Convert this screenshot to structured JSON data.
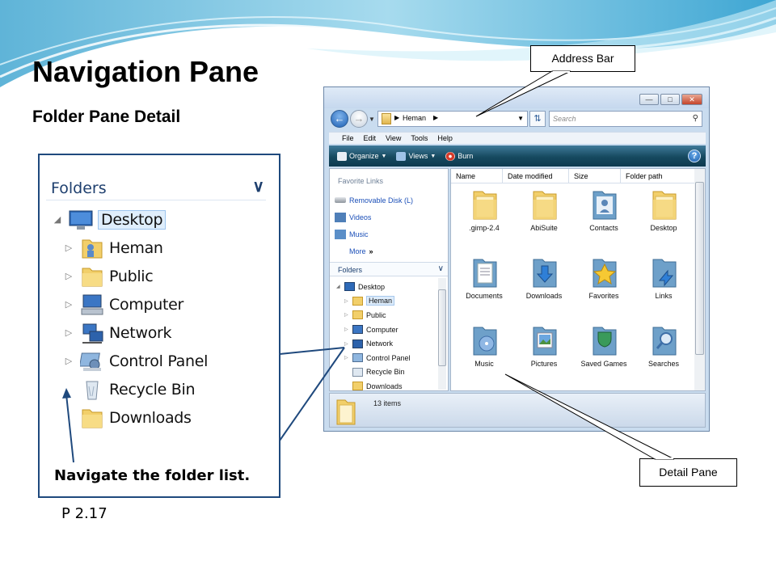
{
  "slide": {
    "title": "Navigation Pane",
    "subtitle": "Folder Pane Detail",
    "caption": "Navigate the folder list.",
    "page_ref": "P 2.17"
  },
  "callouts": {
    "address_bar": "Address Bar",
    "detail_pane": "Detail Pane"
  },
  "enlarged_pane": {
    "header": "Folders",
    "tree": [
      {
        "label": "Desktop",
        "icon": "desktop-icon"
      },
      {
        "label": "Heman",
        "icon": "user-folder-icon"
      },
      {
        "label": "Public",
        "icon": "folder-icon"
      },
      {
        "label": "Computer",
        "icon": "computer-icon"
      },
      {
        "label": "Network",
        "icon": "network-icon"
      },
      {
        "label": "Control Panel",
        "icon": "control-panel-icon"
      },
      {
        "label": "Recycle Bin",
        "icon": "recycle-bin-icon"
      },
      {
        "label": "Downloads",
        "icon": "folder-icon"
      }
    ]
  },
  "window": {
    "address": {
      "crumb": "Heman"
    },
    "search": {
      "placeholder": "Search"
    },
    "menu": [
      "File",
      "Edit",
      "View",
      "Tools",
      "Help"
    ],
    "toolbar": {
      "organize": "Organize",
      "views": "Views",
      "burn": "Burn"
    },
    "favorite_links": {
      "header": "Favorite Links",
      "items": [
        "Removable Disk (L)",
        "Videos",
        "Music",
        "More"
      ]
    },
    "folders": {
      "header": "Folders",
      "tree": [
        "Desktop",
        "Heman",
        "Public",
        "Computer",
        "Network",
        "Control Panel",
        "Recycle Bin",
        "Downloads"
      ]
    },
    "columns": [
      "Name",
      "Date modified",
      "Size",
      "Folder path"
    ],
    "items": [
      {
        "label": ".gimp-2.4",
        "icon": "folder-icon"
      },
      {
        "label": "AbiSuite",
        "icon": "folder-icon"
      },
      {
        "label": "Contacts",
        "icon": "contacts-folder-icon"
      },
      {
        "label": "Desktop",
        "icon": "folder-icon"
      },
      {
        "label": "Documents",
        "icon": "documents-folder-icon"
      },
      {
        "label": "Downloads",
        "icon": "downloads-folder-icon"
      },
      {
        "label": "Favorites",
        "icon": "favorites-folder-icon"
      },
      {
        "label": "Links",
        "icon": "links-folder-icon"
      },
      {
        "label": "Music",
        "icon": "music-folder-icon"
      },
      {
        "label": "Pictures",
        "icon": "pictures-folder-icon"
      },
      {
        "label": "Saved Games",
        "icon": "saved-games-folder-icon"
      },
      {
        "label": "Searches",
        "icon": "searches-folder-icon"
      }
    ],
    "status": "13 items"
  },
  "colors": {
    "box_border": "#1f497d",
    "toolbar": "#16495f",
    "link_blue": "#1b4fb8"
  }
}
